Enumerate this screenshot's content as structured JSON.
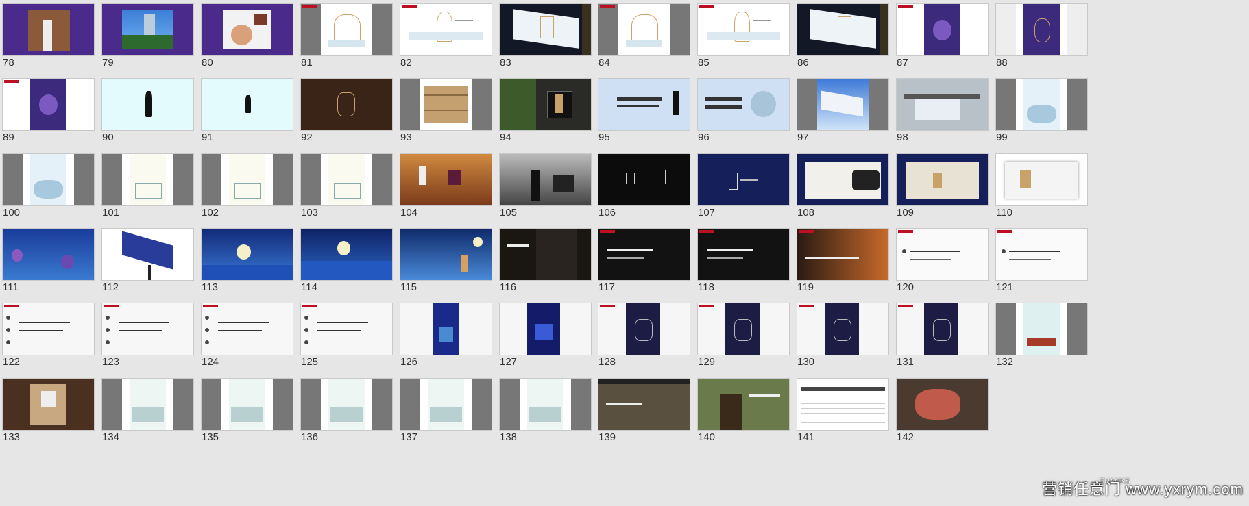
{
  "slides": [
    {
      "n": "78",
      "v": "purple-photo"
    },
    {
      "n": "79",
      "v": "purple-sculpture"
    },
    {
      "n": "80",
      "v": "purple-seal"
    },
    {
      "n": "81",
      "v": "portrait-sketch"
    },
    {
      "n": "82",
      "v": "wide-sketch"
    },
    {
      "n": "83",
      "v": "billboard-night"
    },
    {
      "n": "84",
      "v": "portrait-sketch"
    },
    {
      "n": "85",
      "v": "wide-sketch"
    },
    {
      "n": "86",
      "v": "billboard-night"
    },
    {
      "n": "87",
      "v": "purple-poster"
    },
    {
      "n": "88",
      "v": "purple-poster-grey"
    },
    {
      "n": "89",
      "v": "purple-poster"
    },
    {
      "n": "90",
      "v": "silhouette-cyan"
    },
    {
      "n": "91",
      "v": "silhouette-cyan-small"
    },
    {
      "n": "92",
      "v": "brown-box"
    },
    {
      "n": "93",
      "v": "wood-crate"
    },
    {
      "n": "94",
      "v": "sign-tree"
    },
    {
      "n": "95",
      "v": "banner-blue"
    },
    {
      "n": "96",
      "v": "banner-blue-text"
    },
    {
      "n": "97",
      "v": "billboard-sky"
    },
    {
      "n": "98",
      "v": "bus-stop"
    },
    {
      "n": "99",
      "v": "portrait-blue"
    },
    {
      "n": "100",
      "v": "portrait-blue"
    },
    {
      "n": "101",
      "v": "portrait-cream"
    },
    {
      "n": "102",
      "v": "portrait-cream"
    },
    {
      "n": "103",
      "v": "portrait-cream"
    },
    {
      "n": "104",
      "v": "vineyard"
    },
    {
      "n": "105",
      "v": "bw-photo"
    },
    {
      "n": "106",
      "v": "dark-glasses"
    },
    {
      "n": "107",
      "v": "navy-logo"
    },
    {
      "n": "108",
      "v": "card-glasses"
    },
    {
      "n": "109",
      "v": "card-navy"
    },
    {
      "n": "110",
      "v": "card-white"
    },
    {
      "n": "111",
      "v": "blue-planets"
    },
    {
      "n": "112",
      "v": "billboard-white"
    },
    {
      "n": "113",
      "v": "blue-moon"
    },
    {
      "n": "114",
      "v": "blue-moon2"
    },
    {
      "n": "115",
      "v": "blue-deer"
    },
    {
      "n": "116",
      "v": "dark-photo"
    },
    {
      "n": "117",
      "v": "dark-text"
    },
    {
      "n": "118",
      "v": "dark-text"
    },
    {
      "n": "119",
      "v": "sunset-dark"
    },
    {
      "n": "120",
      "v": "text-light"
    },
    {
      "n": "121",
      "v": "text-light"
    },
    {
      "n": "122",
      "v": "text-list"
    },
    {
      "n": "123",
      "v": "text-list"
    },
    {
      "n": "124",
      "v": "text-list"
    },
    {
      "n": "125",
      "v": "text-list"
    },
    {
      "n": "126",
      "v": "navy-center"
    },
    {
      "n": "127",
      "v": "navy-center2"
    },
    {
      "n": "128",
      "v": "navy-vertical"
    },
    {
      "n": "129",
      "v": "navy-vertical"
    },
    {
      "n": "130",
      "v": "navy-vertical"
    },
    {
      "n": "131",
      "v": "navy-vertical"
    },
    {
      "n": "132",
      "v": "portrait-gate"
    },
    {
      "n": "133",
      "v": "elevator"
    },
    {
      "n": "134",
      "v": "portrait-city"
    },
    {
      "n": "135",
      "v": "portrait-city"
    },
    {
      "n": "136",
      "v": "portrait-city"
    },
    {
      "n": "137",
      "v": "portrait-city"
    },
    {
      "n": "138",
      "v": "portrait-city"
    },
    {
      "n": "139",
      "v": "photo-street"
    },
    {
      "n": "140",
      "v": "photo-man"
    },
    {
      "n": "141",
      "v": "table-sheet"
    },
    {
      "n": "142",
      "v": "photo-red"
    }
  ],
  "watermark": "营销任意门 www.yxrym.com",
  "thanks": "THANKS"
}
